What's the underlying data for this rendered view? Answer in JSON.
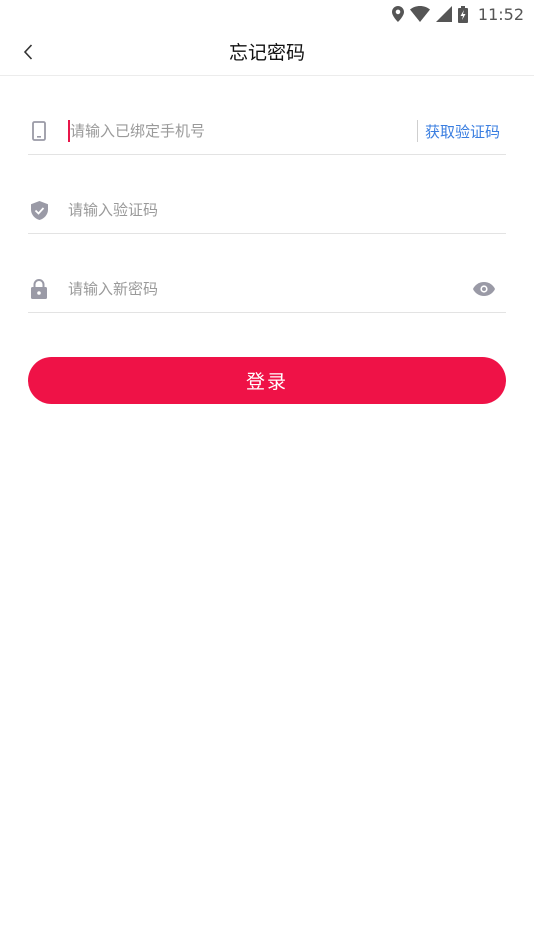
{
  "status_bar": {
    "time": "11:52"
  },
  "nav": {
    "title": "忘记密码"
  },
  "form": {
    "phone_placeholder": "请输入已绑定手机号",
    "get_code_label": "获取验证码",
    "code_placeholder": "请输入验证码",
    "password_placeholder": "请输入新密码"
  },
  "submit": {
    "label": "登录"
  },
  "colors": {
    "accent": "#ef1247",
    "link": "#3a7ee0",
    "icon": "#9a9aa6"
  }
}
